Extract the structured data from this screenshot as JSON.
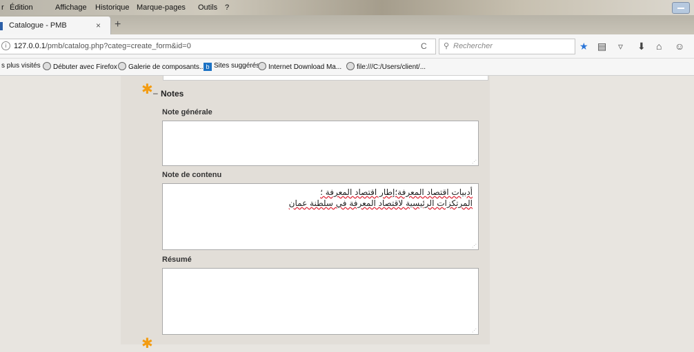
{
  "menu": {
    "items": [
      "r",
      "Édition",
      "Affichage",
      "Historique",
      "Marque-pages",
      "Outils",
      "?"
    ]
  },
  "tab": {
    "title": "Catalogue - PMB",
    "close": "×",
    "new_tab": "+"
  },
  "nav": {
    "info": "i",
    "url_host": "127.0.0.1",
    "url_path": "/pmb/catalog.php?categ=create_form&id=0",
    "reload": "C",
    "search_placeholder": "Rechercher"
  },
  "bookmarks": [
    "s plus visités",
    "Débuter avec Firefox",
    "Galerie de composants...",
    "Sites suggérés",
    "Internet Download Ma...",
    "file:///C:/Users/client/..."
  ],
  "form": {
    "section_title": "Notes",
    "collapse": "–",
    "fields": {
      "note_generale": {
        "label": "Note générale",
        "value": ""
      },
      "note_contenu": {
        "label": "Note de contenu",
        "line1": "أدبيات اقتصاد المعرفة؛إطار اقتصاد المعرفة ؛",
        "line2": "المرتكزات الرئيسية لاقتصاد المعرفة في سلطنة عمان"
      },
      "resume": {
        "label": "Résumé",
        "value": ""
      }
    }
  },
  "colors": {
    "accent_star": "#f39c12",
    "page_bg": "#e8e5e0"
  }
}
